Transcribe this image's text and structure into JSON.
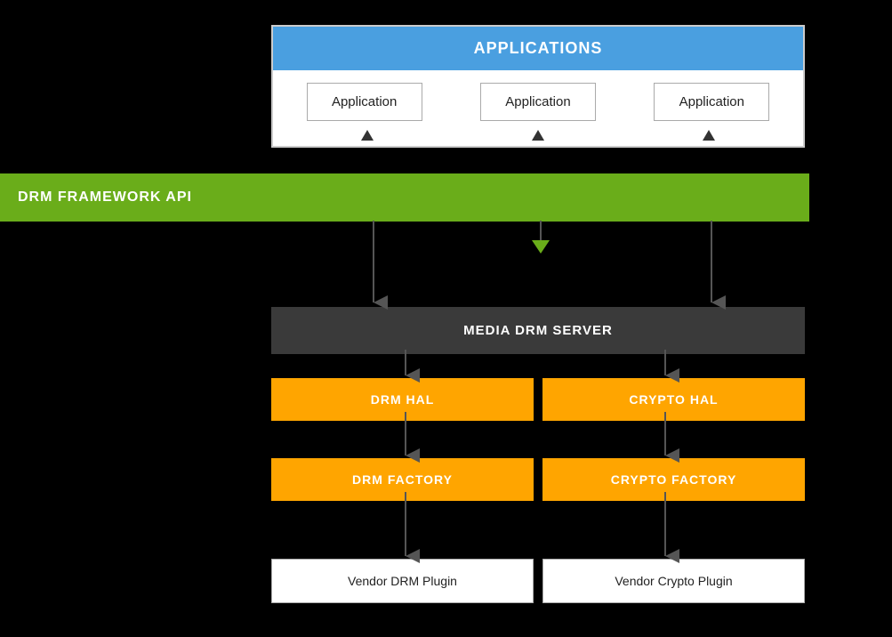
{
  "applications": {
    "header": "APPLICATIONS",
    "items": [
      {
        "label": "Application"
      },
      {
        "label": "Application"
      },
      {
        "label": "Application"
      }
    ]
  },
  "drm_framework": {
    "label": "DRM FRAMEWORK API"
  },
  "media_drm_server": {
    "label": "MEDIA DRM SERVER"
  },
  "hal_row": {
    "drm_hal": "DRM HAL",
    "crypto_hal": "CRYPTO HAL"
  },
  "factory_row": {
    "drm_factory": "DRM FACTORY",
    "crypto_factory": "CRYPTO FACTORY"
  },
  "vendor_row": {
    "drm_plugin": "Vendor DRM Plugin",
    "crypto_plugin": "Vendor Crypto Plugin"
  },
  "colors": {
    "applications_header_bg": "#4A9FE0",
    "drm_framework_bg": "#6AAD1A",
    "media_drm_bg": "#3A3A3A",
    "hal_bg": "#FFA500",
    "factory_bg": "#FFA500",
    "arrow_color": "#555555"
  }
}
